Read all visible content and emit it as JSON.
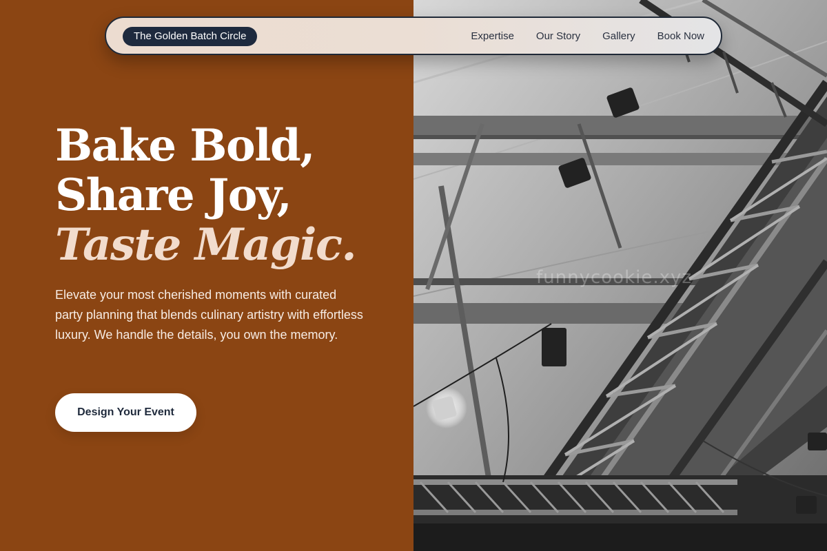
{
  "navbar": {
    "brand": "The Golden Batch Circle",
    "links": [
      "Expertise",
      "Our Story",
      "Gallery",
      "Book Now"
    ]
  },
  "hero": {
    "title_line1": "Bake Bold,",
    "title_line2": "Share Joy,",
    "title_line3": "Taste Magic.",
    "description": "Elevate your most cherished moments with curated party planning that blends culinary artistry with effortless luxury. We handle the details, you own the memory.",
    "cta_label": "Design Your Event"
  },
  "photo": {
    "watermark": "funnycookie.xyz"
  },
  "colors": {
    "left_background": "#8b4513",
    "title_accent": "#f2dccd",
    "brand_pill": "#1e2a3e",
    "navbar_border": "#1f2937"
  }
}
